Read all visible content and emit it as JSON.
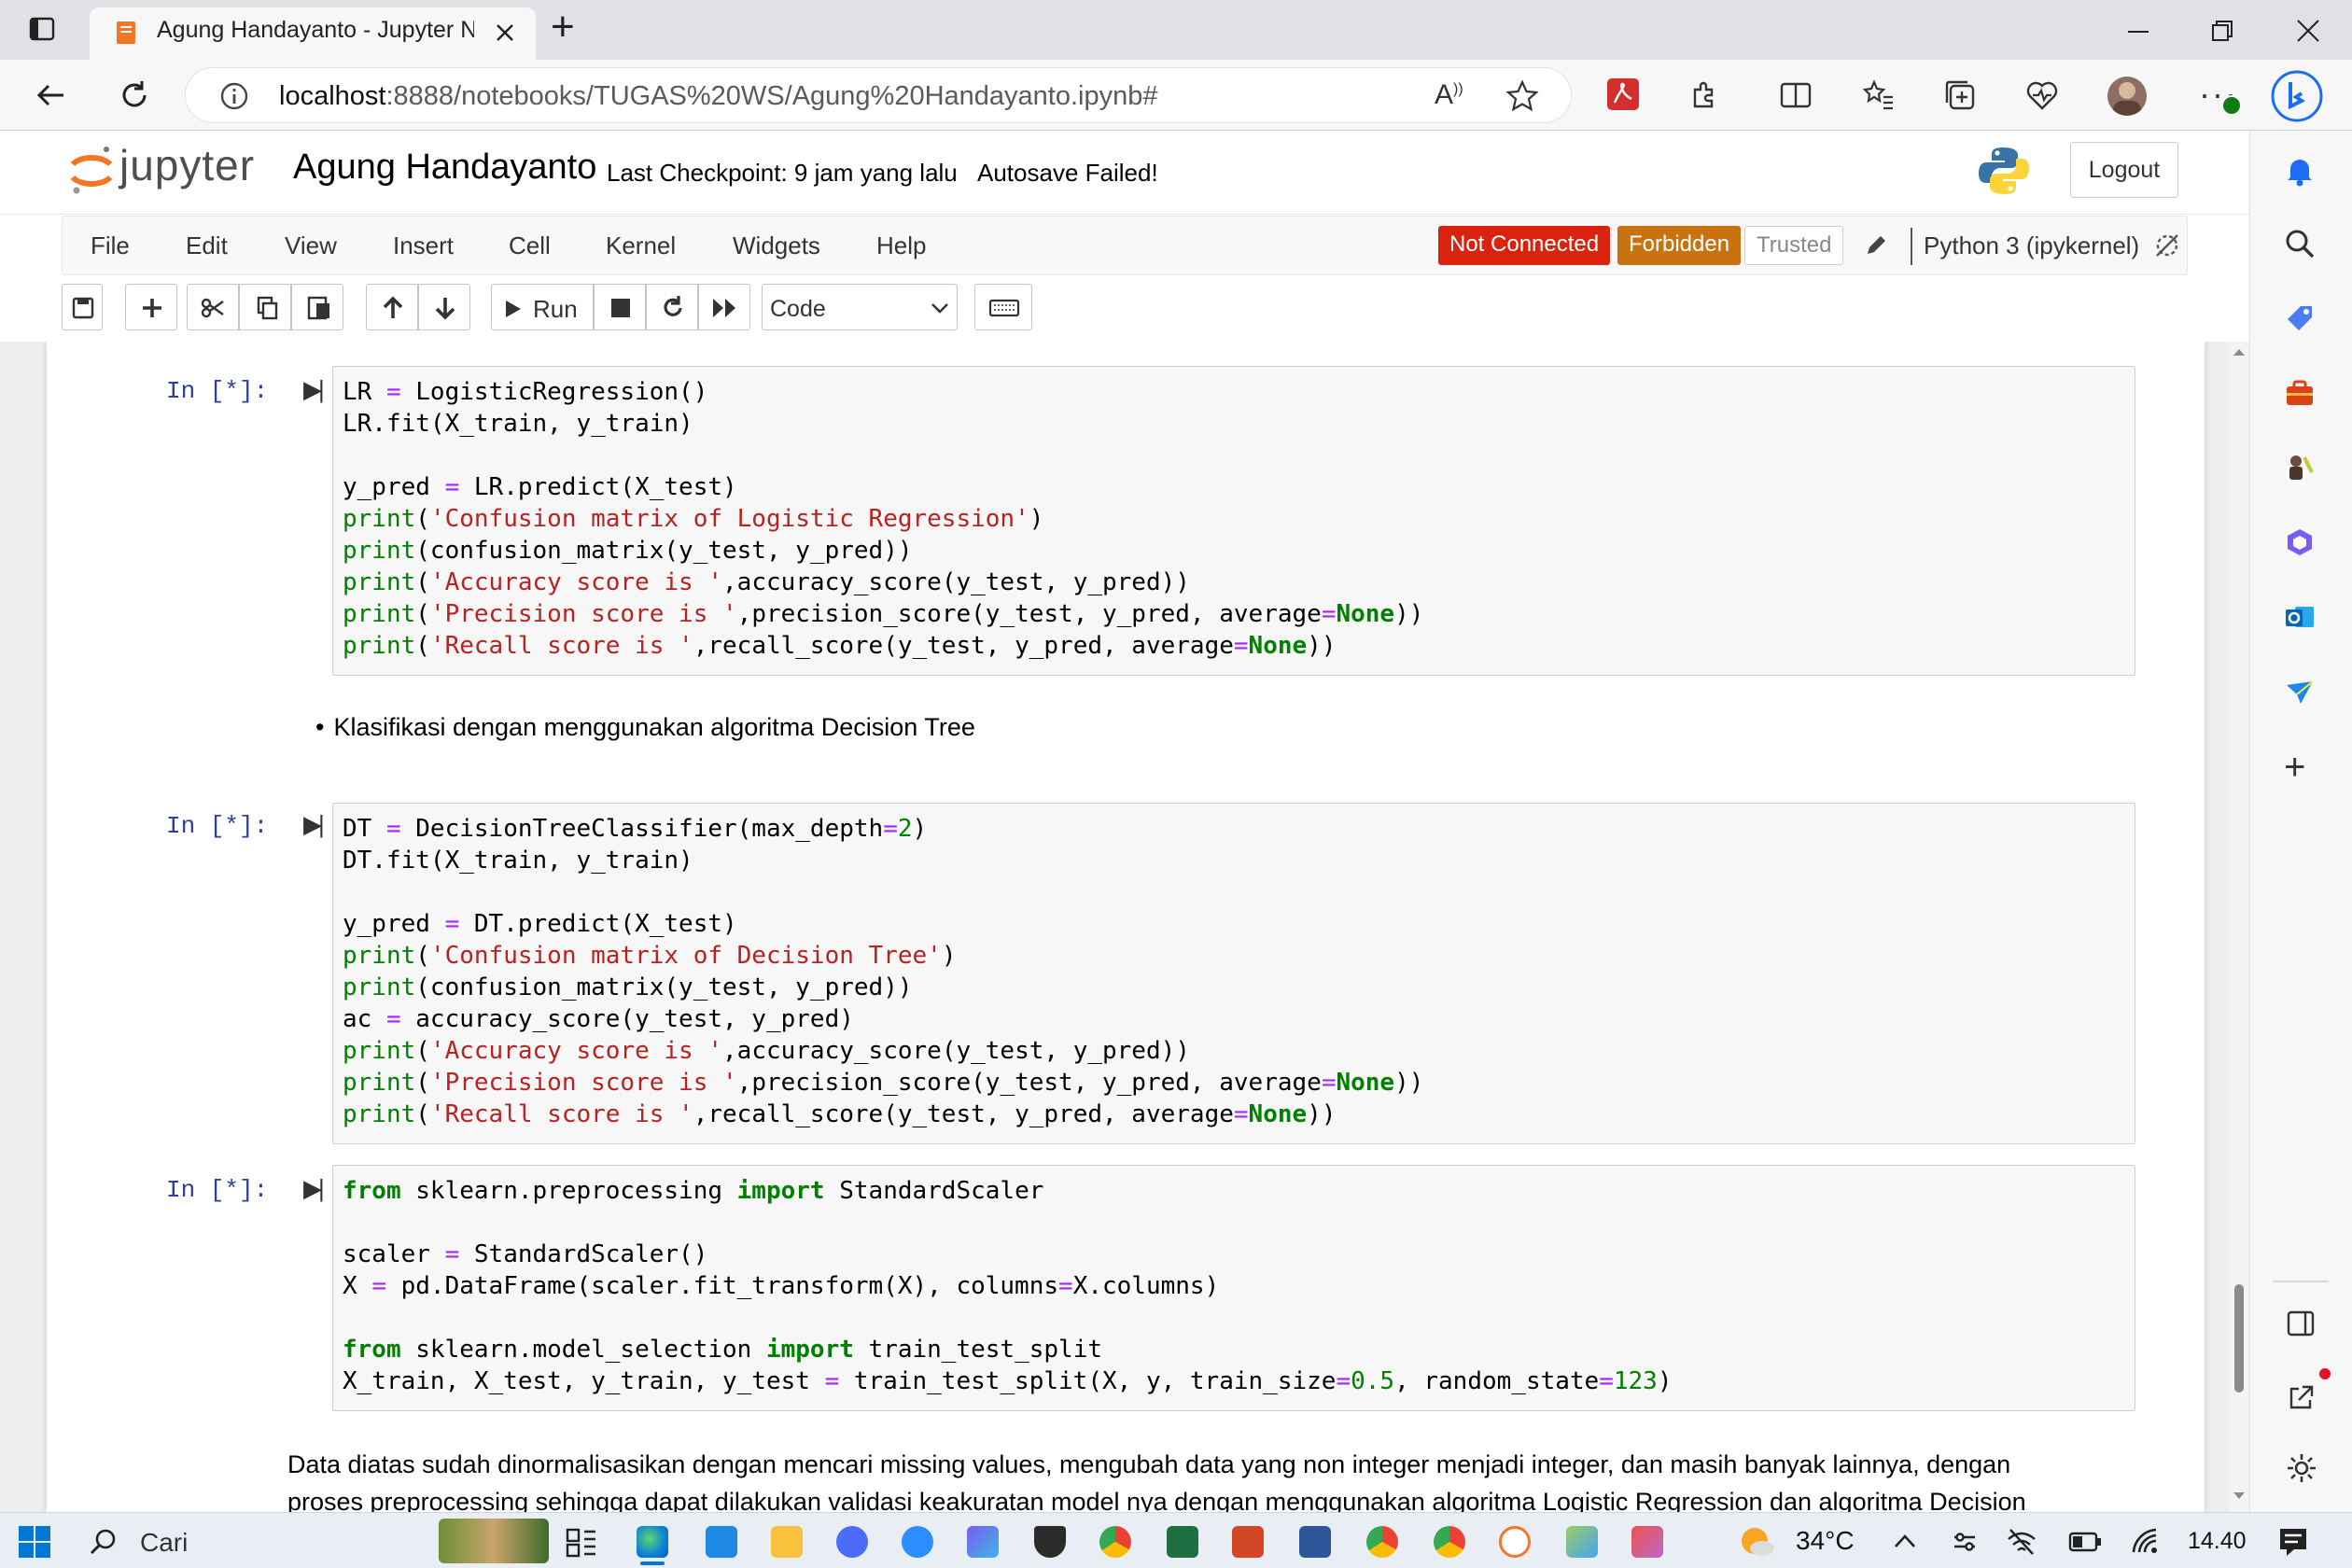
{
  "browser": {
    "tab_title": "Agung Handayanto - Jupyter Notebook",
    "url_host": "localhost",
    "url_rest": ":8888/notebooks/TUGAS%20WS/Agung%20Handayanto.ipynb#",
    "new_tab": "+"
  },
  "jupyter": {
    "logo_text": "jupyter",
    "notebook_name": "Agung Handayanto",
    "checkpoint": "Last Checkpoint: 9 jam yang lalu",
    "autosave": "Autosave Failed!",
    "logout": "Logout",
    "menu": [
      "File",
      "Edit",
      "View",
      "Insert",
      "Cell",
      "Kernel",
      "Widgets",
      "Help"
    ],
    "status_not_connected": "Not Connected",
    "status_forbidden": "Forbidden",
    "status_trusted": "Trusted",
    "kernel_name": "Python 3 (ipykernel)",
    "run_label": "Run",
    "cell_type": "Code",
    "colors": {
      "not_connected": "#d9230f",
      "forbidden": "#c8730f",
      "prompt": "#303f9f"
    }
  },
  "cells": {
    "c1": {
      "prompt": "In [*]:",
      "lines": [
        "LR = LogisticRegression()",
        "LR.fit(X_train, y_train)",
        "",
        "y_pred = LR.predict(X_test)",
        "print('Confusion matrix of Logistic Regression')",
        "print(confusion_matrix(y_test, y_pred))",
        "print('Accuracy score is ',accuracy_score(y_test, y_pred))",
        "print('Precision score is ',precision_score(y_test, y_pred, average=None))",
        "print('Recall score is ',recall_score(y_test, y_pred, average=None))"
      ]
    },
    "md1": "Klasifikasi dengan menggunakan algoritma Decision Tree",
    "c2": {
      "prompt": "In [*]:",
      "lines": [
        "DT = DecisionTreeClassifier(max_depth=2)",
        "DT.fit(X_train, y_train)",
        "",
        "y_pred = DT.predict(X_test)",
        "print('Confusion matrix of Decision Tree')",
        "print(confusion_matrix(y_test, y_pred))",
        "ac = accuracy_score(y_test, y_pred)",
        "print('Accuracy score is ',accuracy_score(y_test, y_pred))",
        "print('Precision score is ',precision_score(y_test, y_pred, average=None))",
        "print('Recall score is ',recall_score(y_test, y_pred, average=None))"
      ]
    },
    "c3": {
      "prompt": "In [*]:",
      "lines": [
        "from sklearn.preprocessing import StandardScaler",
        "",
        "scaler = StandardScaler()",
        "X = pd.DataFrame(scaler.fit_transform(X), columns=X.columns)",
        "",
        "from sklearn.model_selection import train_test_split",
        "X_train, X_test, y_train, y_test = train_test_split(X, y, train_size=0.5, random_state=123)"
      ]
    },
    "md2_line1": "Data diatas sudah dinormalisasikan dengan mencari missing values, mengubah data yang non integer menjadi integer, dan masih banyak lainnya, dengan",
    "md2_line2": "proses preprocessing sehingga dapat dilakukan validasi keakuratan model nya dengan menggunakan algoritma Logistic Regression dan algoritma Decision"
  },
  "taskbar": {
    "search_placeholder": "Cari",
    "weather": "34°C",
    "time": "14.40"
  }
}
